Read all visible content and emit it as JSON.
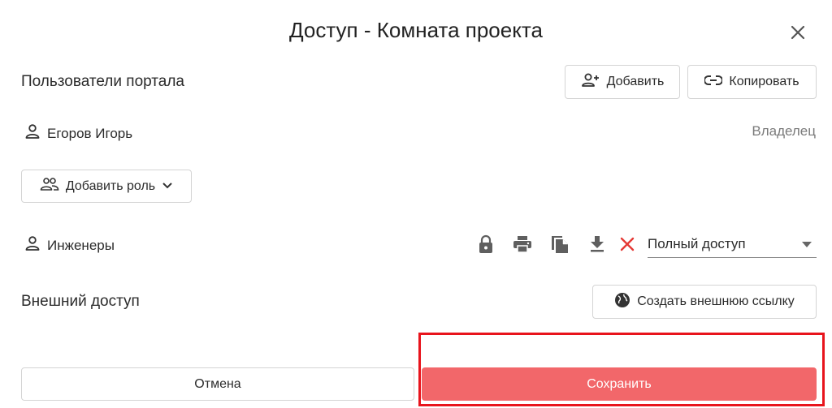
{
  "dialog": {
    "title": "Доступ - Комната проекта"
  },
  "portal_users": {
    "label": "Пользователи портала",
    "add_button": "Добавить",
    "copy_button": "Копировать"
  },
  "owner": {
    "name": "Егоров Игорь",
    "role": "Владелец"
  },
  "add_role": {
    "label": "Добавить роль"
  },
  "role_group": {
    "name": "Инженеры",
    "access_level": "Полный доступ",
    "icons": [
      "lock-icon",
      "print-icon",
      "copy-file-icon",
      "download-icon",
      "remove-icon"
    ]
  },
  "external_access": {
    "label": "Внешний доступ",
    "create_link_button": "Создать внешнюю ссылку"
  },
  "footer": {
    "cancel_label": "Отмена",
    "save_label": "Сохранить"
  },
  "colors": {
    "save_button": "#f2676a",
    "highlight": "#e8141c",
    "remove_icon": "#e53935",
    "icon_gray": "#5f5f5f"
  }
}
